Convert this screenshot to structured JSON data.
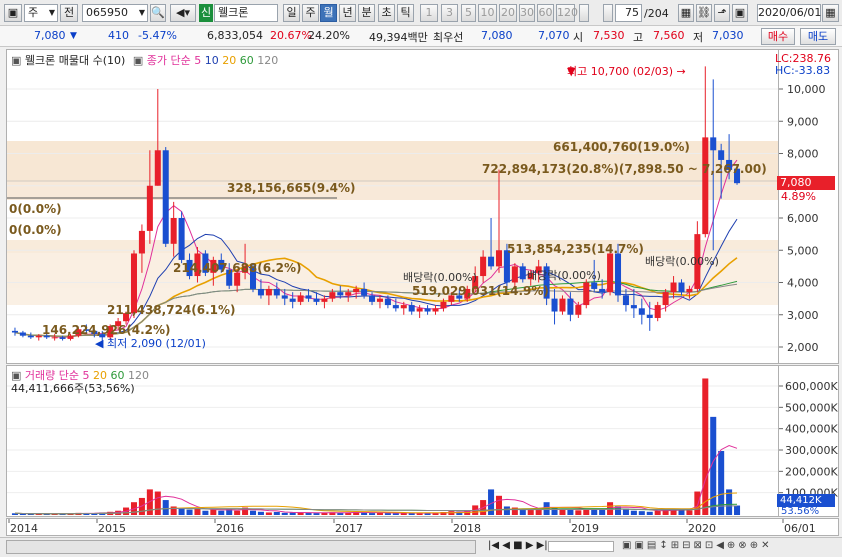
{
  "toolbar": {
    "period_label": "주",
    "prev_label": "전",
    "code": "065950",
    "credit_badge": "신",
    "stock_name": "웰크론",
    "tabs": [
      "일",
      "주",
      "월",
      "년",
      "분",
      "초",
      "틱"
    ],
    "active_tab": "월",
    "numbers": [
      "1",
      "3",
      "5",
      "10",
      "20",
      "30",
      "60",
      "120"
    ],
    "count": "75",
    "total": "/204",
    "date": "2020/06/01"
  },
  "quote": {
    "price": "7,080",
    "change_arrow": "▼",
    "change": "410",
    "change_pct": "-5.47%",
    "volume": "6,833,054",
    "turnover_pct": "20.67%",
    "ratio_pct": "24.20%",
    "amount": "49,394백만",
    "priority_label": "최우선",
    "ask": "7,080",
    "bid": "7,070",
    "open_label": "시",
    "open": "7,530",
    "high_label": "고",
    "high": "7,560",
    "low_label": "저",
    "low": "7,030",
    "buy_label": "매수",
    "sell_label": "매도"
  },
  "price_panel": {
    "title": "웰크론 매물대 수(10)",
    "ma_title": "종가 단순",
    "ma_periods": [
      "5",
      "10",
      "20",
      "60",
      "120"
    ],
    "lc": "LC:238.76",
    "hc": "HC:-33.83",
    "high_note": "최고 10,700 (02/03)",
    "low_note": "최저 2,090 (12/01)",
    "current_price": "7,080",
    "current_pct": "4.89%",
    "dividend_labels": [
      "배당락(0.00%)",
      "배당락(0.00%)",
      "배당락(0.00%)"
    ],
    "zone_labels": [
      "661,400,760(19.0%)",
      "722,894,173(20.8%)(7,898.50 ~ 7,267.00)",
      "328,156,665(9.4%)",
      "0(0.0%)",
      "0(0.0%)",
      "513,854,235(14.7%)",
      "214,407,688(6.2%)",
      "519,029,031(14.9%)",
      "211,438,724(6.1%)",
      "146,224,926(4.2%)"
    ],
    "y_ticks": [
      "10,000",
      "9,000",
      "8,000",
      "7,000",
      "6,000",
      "5,000",
      "4,000",
      "3,000",
      "2,000"
    ]
  },
  "volume_panel": {
    "title": "거래량 단순",
    "ma_periods": [
      "5",
      "20",
      "60",
      "120"
    ],
    "last_volume": "44,411,666주(53,56%)",
    "badge_value": "44,412K",
    "badge_pct": "53.56%",
    "y_ticks": [
      "600,000K",
      "500,000K",
      "400,000K",
      "300,000K",
      "200,000K",
      "100,000K"
    ]
  },
  "x_axis": [
    "2014",
    "2015",
    "2016",
    "2017",
    "2018",
    "2019",
    "2020",
    "06/01"
  ],
  "colors": {
    "up": "#e8202a",
    "down": "#1a4fd0",
    "ma5": "#e0309a",
    "ma10": "#1e3fb0",
    "ma20": "#e8a000",
    "ma60": "#2e9a3a",
    "ma120": "#888888",
    "zone": "#f6e4cf"
  },
  "chart_data": {
    "type": "candlestick",
    "interval": "monthly",
    "ylim": [
      1500,
      11000
    ],
    "candles": [
      [
        2500,
        2600,
        2350,
        2450
      ],
      [
        2450,
        2500,
        2300,
        2350
      ],
      [
        2350,
        2450,
        2250,
        2300
      ],
      [
        2300,
        2400,
        2200,
        2350
      ],
      [
        2350,
        2450,
        2250,
        2300
      ],
      [
        2300,
        2400,
        2200,
        2300
      ],
      [
        2300,
        2350,
        2200,
        2250
      ],
      [
        2250,
        2400,
        2200,
        2350
      ],
      [
        2350,
        2600,
        2300,
        2550
      ],
      [
        2550,
        2700,
        2450,
        2500
      ],
      [
        2500,
        2550,
        2300,
        2400
      ],
      [
        2400,
        2500,
        2090,
        2300
      ],
      [
        2300,
        2700,
        2250,
        2650
      ],
      [
        2650,
        2900,
        2550,
        2800
      ],
      [
        2800,
        3100,
        2700,
        3050
      ],
      [
        3050,
        5000,
        2900,
        4900
      ],
      [
        4900,
        5800,
        4300,
        5600
      ],
      [
        5600,
        8100,
        5200,
        7000
      ],
      [
        7000,
        10000,
        7000,
        8100
      ],
      [
        8100,
        8200,
        5100,
        5200
      ],
      [
        5200,
        6500,
        4800,
        6000
      ],
      [
        6000,
        6200,
        4600,
        4700
      ],
      [
        4700,
        4900,
        4100,
        4200
      ],
      [
        4200,
        5100,
        4000,
        4900
      ],
      [
        4900,
        5000,
        4200,
        4300
      ],
      [
        4300,
        4800,
        3900,
        4700
      ],
      [
        4700,
        4900,
        4300,
        4400
      ],
      [
        4400,
        4600,
        3800,
        3900
      ],
      [
        3900,
        4400,
        3700,
        4300
      ],
      [
        4300,
        5200,
        4100,
        4500
      ],
      [
        4500,
        4600,
        3700,
        3800
      ],
      [
        3800,
        4100,
        3500,
        3600
      ],
      [
        3600,
        3900,
        3300,
        3800
      ],
      [
        3800,
        4000,
        3500,
        3600
      ],
      [
        3600,
        3800,
        3300,
        3500
      ],
      [
        3500,
        3700,
        3200,
        3400
      ],
      [
        3400,
        3700,
        3300,
        3600
      ],
      [
        3600,
        3800,
        3400,
        3500
      ],
      [
        3500,
        3700,
        3300,
        3400
      ],
      [
        3400,
        3600,
        3200,
        3500
      ],
      [
        3500,
        3800,
        3400,
        3700
      ],
      [
        3700,
        3900,
        3500,
        3600
      ],
      [
        3600,
        3800,
        3400,
        3700
      ],
      [
        3700,
        3900,
        3500,
        3800
      ],
      [
        3800,
        4000,
        3500,
        3600
      ],
      [
        3600,
        3700,
        3300,
        3400
      ],
      [
        3400,
        3600,
        3200,
        3500
      ],
      [
        3500,
        3600,
        3200,
        3300
      ],
      [
        3300,
        3500,
        3100,
        3200
      ],
      [
        3200,
        3400,
        3000,
        3300
      ],
      [
        3300,
        3400,
        3000,
        3100
      ],
      [
        3100,
        3300,
        2900,
        3200
      ],
      [
        3200,
        3300,
        3000,
        3100
      ],
      [
        3100,
        3300,
        3000,
        3200
      ],
      [
        3200,
        3500,
        3100,
        3400
      ],
      [
        3400,
        3700,
        3300,
        3600
      ],
      [
        3600,
        3800,
        3400,
        3500
      ],
      [
        3500,
        3900,
        3400,
        3800
      ],
      [
        3800,
        4500,
        3700,
        4200
      ],
      [
        4200,
        5000,
        4000,
        4800
      ],
      [
        4800,
        6000,
        4400,
        4500
      ],
      [
        4500,
        7500,
        4300,
        5000
      ],
      [
        5000,
        5200,
        3800,
        4000
      ],
      [
        4000,
        4600,
        3800,
        4500
      ],
      [
        4500,
        4600,
        4000,
        4100
      ],
      [
        4100,
        4400,
        3900,
        4300
      ],
      [
        4300,
        4700,
        4000,
        4500
      ],
      [
        4500,
        4600,
        3300,
        3500
      ],
      [
        3500,
        3800,
        2700,
        3100
      ],
      [
        3100,
        3600,
        3000,
        3500
      ],
      [
        3500,
        3700,
        2800,
        3000
      ],
      [
        3000,
        3400,
        2900,
        3300
      ],
      [
        3300,
        4100,
        3200,
        4000
      ],
      [
        4000,
        4700,
        3700,
        3800
      ],
      [
        3800,
        4100,
        3500,
        3700
      ],
      [
        3700,
        5100,
        3600,
        4900
      ],
      [
        4900,
        5200,
        3400,
        3600
      ],
      [
        3600,
        3800,
        3100,
        3300
      ],
      [
        3300,
        3800,
        2900,
        3200
      ],
      [
        3200,
        3500,
        2700,
        3000
      ],
      [
        3000,
        3400,
        2500,
        2900
      ],
      [
        2900,
        3400,
        2800,
        3300
      ],
      [
        3300,
        3800,
        3100,
        3700
      ],
      [
        3700,
        4200,
        3500,
        4000
      ],
      [
        4000,
        4100,
        3600,
        3700
      ],
      [
        3700,
        3900,
        3500,
        3800
      ],
      [
        3800,
        5900,
        3700,
        5500
      ],
      [
        5500,
        10700,
        5400,
        8500
      ],
      [
        8500,
        10300,
        5000,
        8100
      ],
      [
        8100,
        8300,
        6600,
        7800
      ],
      [
        7800,
        8600,
        7200,
        7490
      ],
      [
        7530,
        7560,
        7030,
        7080
      ]
    ],
    "volumes": [
      8,
      6,
      5,
      7,
      5,
      6,
      5,
      8,
      10,
      9,
      7,
      12,
      15,
      20,
      35,
      60,
      80,
      120,
      110,
      70,
      40,
      30,
      25,
      30,
      20,
      25,
      20,
      30,
      20,
      35,
      20,
      15,
      12,
      14,
      10,
      11,
      12,
      10,
      9,
      11,
      13,
      10,
      12,
      15,
      11,
      9,
      10,
      9,
      8,
      10,
      9,
      8,
      9,
      10,
      14,
      18,
      16,
      22,
      45,
      70,
      120,
      90,
      40,
      35,
      30,
      25,
      28,
      60,
      35,
      30,
      25,
      22,
      28,
      30,
      25,
      60,
      40,
      30,
      20,
      18,
      15,
      20,
      25,
      30,
      25,
      22,
      110,
      640,
      460,
      300,
      120,
      44.4
    ]
  }
}
